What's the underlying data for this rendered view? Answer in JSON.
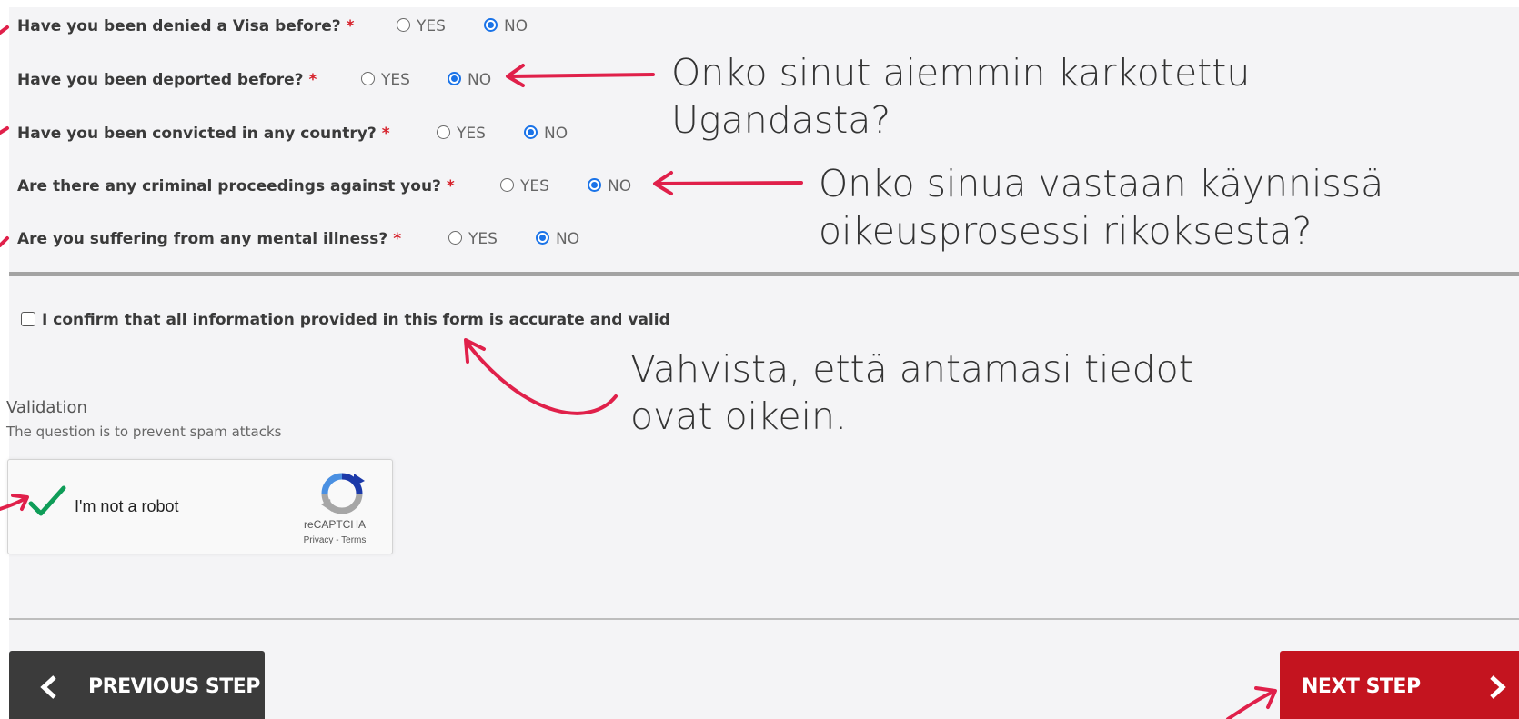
{
  "questions": [
    {
      "label": "Have you been denied a Visa before?",
      "required": "*",
      "yes": "YES",
      "no": "NO",
      "selected": "NO"
    },
    {
      "label": "Have you been deported before?",
      "required": "*",
      "yes": "YES",
      "no": "NO",
      "selected": "NO"
    },
    {
      "label": "Have you been convicted in any country?",
      "required": "*",
      "yes": "YES",
      "no": "NO",
      "selected": "NO"
    },
    {
      "label": "Are there any criminal proceedings against you?",
      "required": "*",
      "yes": "YES",
      "no": "NO",
      "selected": "NO"
    },
    {
      "label": "Are you suffering from any mental illness?",
      "required": "*",
      "yes": "YES",
      "no": "NO",
      "selected": "NO"
    }
  ],
  "confirm": {
    "label": "I confirm that all information provided in this form is accurate and valid",
    "checked": false
  },
  "validation": {
    "title": "Validation",
    "subtitle": "The question is to prevent spam attacks"
  },
  "captcha": {
    "label": "I'm not a robot",
    "brand": "reCAPTCHA",
    "links": "Privacy - Terms",
    "checked": true
  },
  "buttons": {
    "previous": "PREVIOUS STEP",
    "next": "NEXT STEP"
  },
  "annotations": {
    "deported": [
      "Onko sinut aiemmin karkotettu",
      "Ugandasta?"
    ],
    "proceedings": [
      "Onko sinua vastaan käynnissä",
      "oikeusprosessi rikoksesta?"
    ],
    "confirm": [
      "Vahvista, että antamasi tiedot",
      "ovat oikein."
    ]
  },
  "colors": {
    "accent_red": "#c4141f",
    "annotation_arrow": "#e0204a",
    "radio_selected": "#1a73e8",
    "captcha_check": "#0f9d58"
  }
}
